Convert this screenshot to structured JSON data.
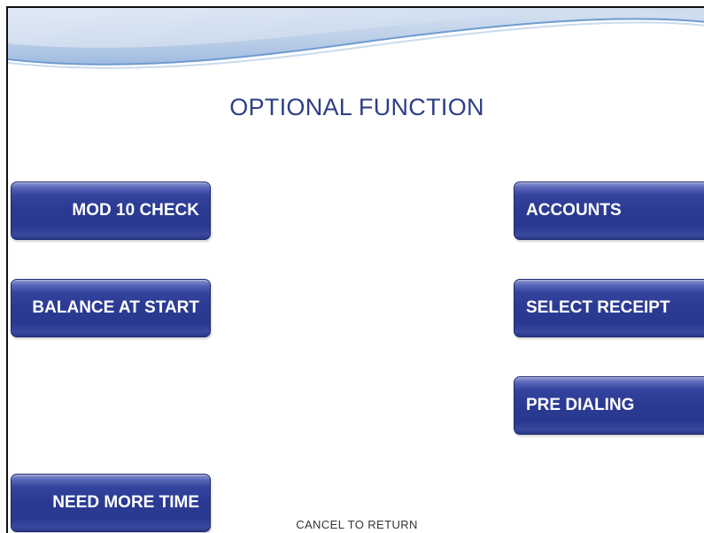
{
  "screen": {
    "title": "OPTIONAL FUNCTION",
    "footer": "CANCEL TO RETURN"
  },
  "buttons": {
    "left": [
      {
        "label": "MOD 10 CHECK"
      },
      {
        "label": "BALANCE AT START"
      },
      {
        "label": "NEED MORE TIME"
      }
    ],
    "right": [
      {
        "label": "ACCOUNTS"
      },
      {
        "label": "SELECT RECEIPT"
      },
      {
        "label": "PRE DIALING"
      }
    ]
  },
  "colors": {
    "title": "#2e3f86",
    "button": "#2a3a92",
    "header_wave": "#b8cde6"
  }
}
